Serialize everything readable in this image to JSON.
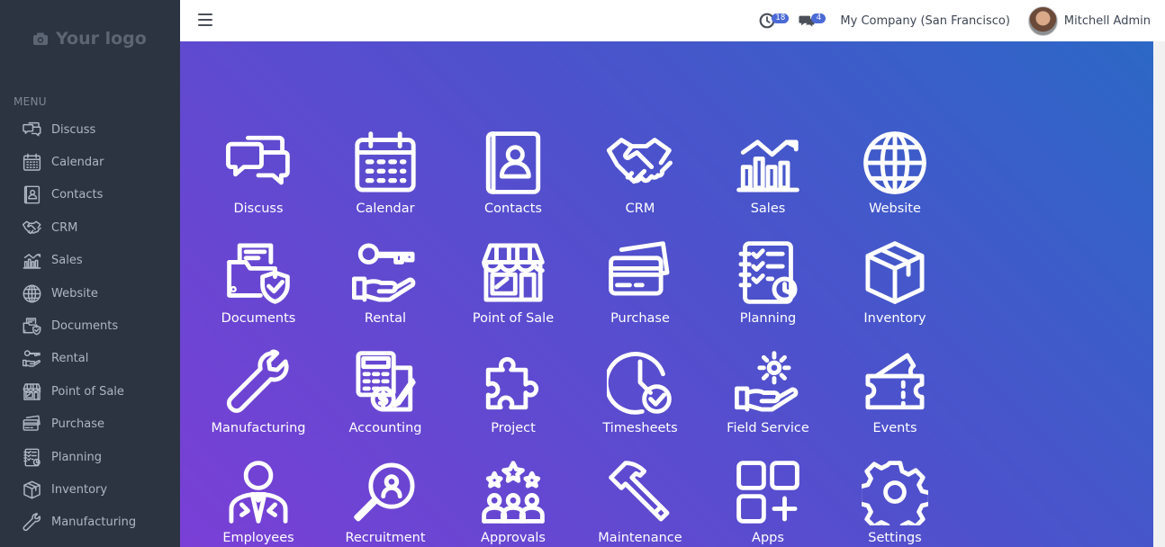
{
  "logo": {
    "text": "Your logo"
  },
  "sidebar": {
    "menu_title": "MENU",
    "items": [
      {
        "label": "Discuss",
        "icon": "chat-icon"
      },
      {
        "label": "Calendar",
        "icon": "calendar-icon"
      },
      {
        "label": "Contacts",
        "icon": "contact-card-icon"
      },
      {
        "label": "CRM",
        "icon": "handshake-icon"
      },
      {
        "label": "Sales",
        "icon": "bar-chart-icon"
      },
      {
        "label": "Website",
        "icon": "globe-icon"
      },
      {
        "label": "Documents",
        "icon": "document-folder-icon"
      },
      {
        "label": "Rental",
        "icon": "key-hand-icon"
      },
      {
        "label": "Point of Sale",
        "icon": "store-icon"
      },
      {
        "label": "Purchase",
        "icon": "credit-card-icon"
      },
      {
        "label": "Planning",
        "icon": "checklist-icon"
      },
      {
        "label": "Inventory",
        "icon": "box-icon"
      },
      {
        "label": "Manufacturing",
        "icon": "wrench-icon"
      }
    ]
  },
  "topbar": {
    "activity_count": "18",
    "messages_count": "4",
    "company": "My Company (San Francisco)",
    "user": "Mitchell Admin"
  },
  "apps": [
    {
      "label": "Discuss",
      "icon": "chat-icon"
    },
    {
      "label": "Calendar",
      "icon": "calendar-icon"
    },
    {
      "label": "Contacts",
      "icon": "contact-card-icon"
    },
    {
      "label": "CRM",
      "icon": "handshake-icon"
    },
    {
      "label": "Sales",
      "icon": "bar-chart-icon"
    },
    {
      "label": "Website",
      "icon": "globe-icon"
    },
    {
      "label": "Documents",
      "icon": "document-folder-icon"
    },
    {
      "label": "Rental",
      "icon": "key-hand-icon"
    },
    {
      "label": "Point of Sale",
      "icon": "store-icon"
    },
    {
      "label": "Purchase",
      "icon": "credit-card-icon"
    },
    {
      "label": "Planning",
      "icon": "checklist-icon"
    },
    {
      "label": "Inventory",
      "icon": "box-icon"
    },
    {
      "label": "Manufacturing",
      "icon": "wrench-icon"
    },
    {
      "label": "Accounting",
      "icon": "calculator-icon"
    },
    {
      "label": "Project",
      "icon": "puzzle-icon"
    },
    {
      "label": "Timesheets",
      "icon": "clock-check-icon"
    },
    {
      "label": "Field Service",
      "icon": "gear-hand-icon"
    },
    {
      "label": "Events",
      "icon": "ticket-icon"
    },
    {
      "label": "Employees",
      "icon": "employee-icon"
    },
    {
      "label": "Recruitment",
      "icon": "magnifier-person-icon"
    },
    {
      "label": "Approvals",
      "icon": "group-stars-icon"
    },
    {
      "label": "Maintenance",
      "icon": "hammer-icon"
    },
    {
      "label": "Apps",
      "icon": "apps-grid-icon"
    },
    {
      "label": "Settings",
      "icon": "settings-gear-icon"
    }
  ],
  "colors": {
    "sidebar_bg": "#2c3442",
    "gradient_start": "#7a3fd6",
    "gradient_end": "#2c68c6",
    "badge": "#4b6ad6"
  }
}
